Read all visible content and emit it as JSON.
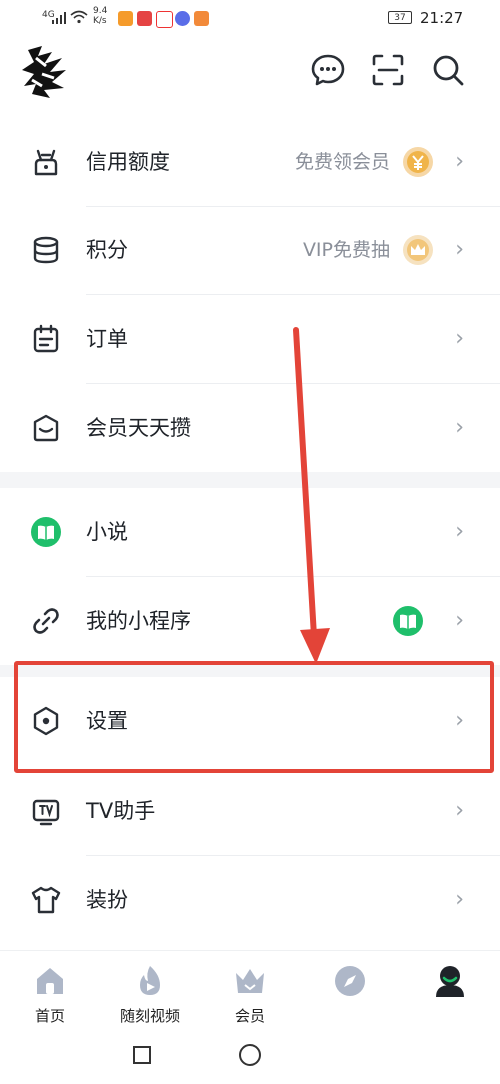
{
  "status_bar": {
    "signal_label": "4G",
    "speed_value": "9.4",
    "speed_unit": "K/s",
    "battery": "37",
    "time": "21:27"
  },
  "header": {
    "icons": [
      "message-icon",
      "scan-icon",
      "search-icon"
    ]
  },
  "menu": {
    "credit": {
      "label": "信用额度",
      "right_text": "免费领会员",
      "badge_icon": "yen-coin-icon"
    },
    "points": {
      "label": "积分",
      "right_text": "VIP免费抽",
      "badge_icon": "crown-coin-icon"
    },
    "orders": {
      "label": "订单"
    },
    "member_daily": {
      "label": "会员天天攒"
    },
    "novel": {
      "label": "小说"
    },
    "mini_programs": {
      "label": "我的小程序",
      "badge_icon": "book-badge-icon"
    },
    "settings": {
      "label": "设置"
    },
    "tv_helper": {
      "label": "TV助手"
    },
    "dress_up": {
      "label": "装扮"
    },
    "chevron": "›"
  },
  "bottom_nav": {
    "home": "首页",
    "video": "随刻视频",
    "vip": "会员",
    "discover": "",
    "me": ""
  },
  "colors": {
    "accent_red": "#e34438",
    "green": "#1fbf6b",
    "gold": "#f0b44a",
    "icon_gray": "#aeb7c8"
  }
}
